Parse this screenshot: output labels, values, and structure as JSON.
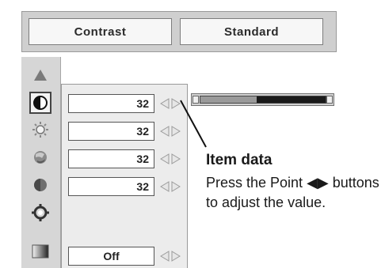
{
  "header": {
    "left_label": "Contrast",
    "right_label": "Standard"
  },
  "icons": [
    {
      "name": "scroll-up-icon",
      "selected": false
    },
    {
      "name": "contrast-icon",
      "selected": true
    },
    {
      "name": "brightness-icon",
      "selected": false
    },
    {
      "name": "color-icon",
      "selected": false
    },
    {
      "name": "tint-icon",
      "selected": false
    },
    {
      "name": "sharpness-icon",
      "selected": false
    },
    {
      "name": "gamma-icon",
      "selected": false
    }
  ],
  "items": [
    {
      "value": "32"
    },
    {
      "value": "32"
    },
    {
      "value": "32"
    },
    {
      "value": "32"
    },
    {
      "value": "Off"
    }
  ],
  "slider": {
    "level": 0.45
  },
  "callout": {
    "title": "Item data",
    "text": "Press the Point ◀▶ buttons to adjust the value."
  },
  "colors": {
    "panel_bg": "#ececec",
    "icon_column_bg": "#d6d6d6",
    "header_bg": "#cfcfcf"
  }
}
